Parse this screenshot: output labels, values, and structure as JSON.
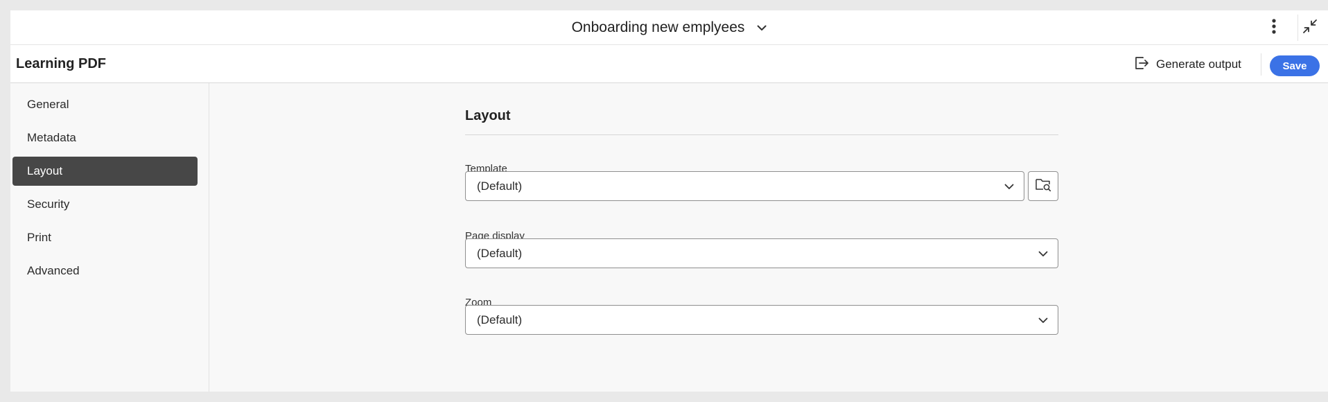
{
  "header": {
    "document_title": "Onboarding new emplyees",
    "icons": [
      "chevron-down-icon",
      "more-vertical-icon",
      "collapse-icon"
    ]
  },
  "subheader": {
    "app_title": "Learning PDF",
    "generate_label": "Generate output",
    "save_label": "Save"
  },
  "sidebar": {
    "items": [
      {
        "label": "General",
        "active": false
      },
      {
        "label": "Metadata",
        "active": false
      },
      {
        "label": "Layout",
        "active": true
      },
      {
        "label": "Security",
        "active": false
      },
      {
        "label": "Print",
        "active": false
      },
      {
        "label": "Advanced",
        "active": false
      }
    ]
  },
  "main": {
    "section_title": "Layout",
    "fields": [
      {
        "label": "Template",
        "value": "(Default)"
      },
      {
        "label": "Page display",
        "value": "(Default)"
      },
      {
        "label": "Zoom",
        "value": "(Default)"
      }
    ]
  },
  "colors": {
    "accent": "#3b72e6",
    "active_nav": "#474747",
    "background": "#f8f8f8"
  }
}
